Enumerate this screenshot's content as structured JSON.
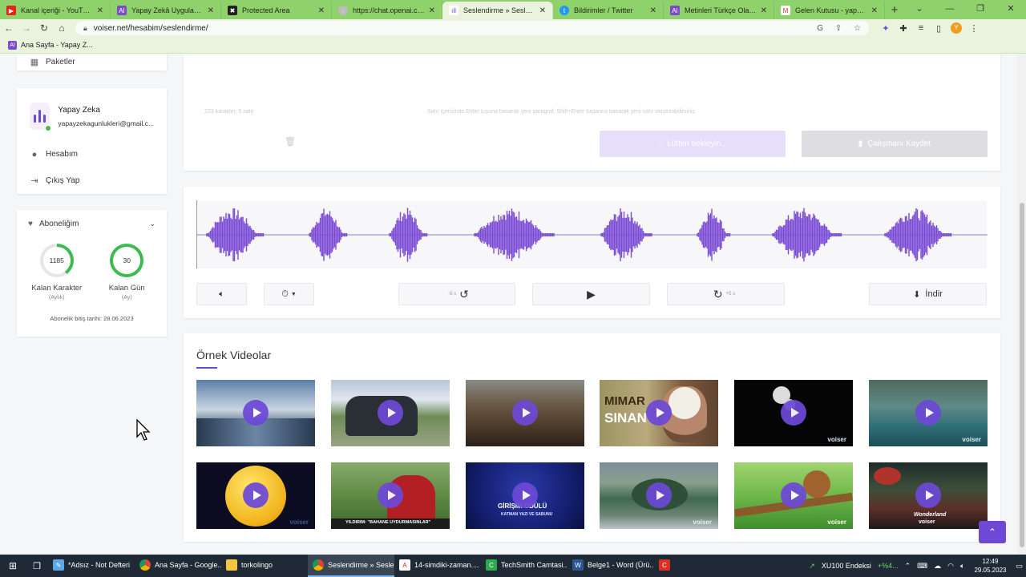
{
  "browser": {
    "tabs": [
      {
        "label": "Kanal içeriği - YouTube St...",
        "favicon": "youtube-icon",
        "color": "#e62117"
      },
      {
        "label": "Yapay Zekâ Uygulamaları...",
        "favicon": "ai-icon",
        "color": "#7b4bc9"
      },
      {
        "label": "Protected Area",
        "favicon": "shield-icon",
        "color": "#222222"
      },
      {
        "label": "https://chat.openai.com",
        "favicon": "globe-icon",
        "color": "#888888"
      },
      {
        "label": "Seslendirme » Seslendirme",
        "favicon": "voiser-icon",
        "color": "#6a4bd0",
        "active": true
      },
      {
        "label": "Bildirimler / Twitter",
        "favicon": "twitter-icon",
        "color": "#1d9bf0"
      },
      {
        "label": "Metinleri Türkçe Olarak Se...",
        "favicon": "ai-icon",
        "color": "#7b4bc9"
      },
      {
        "label": "Gelen Kutusu - yapayzeka...",
        "favicon": "gmail-icon",
        "color": "#d93025"
      }
    ],
    "url": "voiser.net/hesabim/seslendirme/",
    "bookmark": "Ana Sayfa - Yapay Z...",
    "avatar_letter": "Y"
  },
  "sidebar": {
    "packages_label": "Paketler",
    "user": {
      "name": "Yapay Zeka",
      "email": "yapayzekagunlukleri@gmail.c..."
    },
    "account_label": "Hesabım",
    "logout_label": "Çıkış Yap",
    "subscription": {
      "title": "Aboneliğim",
      "chars_value": "1185",
      "chars_label": "Kalan Karakter",
      "chars_period": "(Aylık)",
      "days_value": "30",
      "days_label": "Kalan Gün",
      "days_period": "(Ay)",
      "end_text": "Abonelik bitiş tarihi: 28.06.2023",
      "ring_color": "#3dbb4f"
    }
  },
  "editor": {
    "hint": "Satır içerisinde Enter tuşuna basarak yeni paragraf, Shift+Enter tuşlarına basarak yeni satır oluşturabilirsiniz.",
    "counter": "223 karakter, 5 satır",
    "wait_label": "Lütfen bekleyin...",
    "save_label": "Çalışmanı Kaydet"
  },
  "player": {
    "back_label": "-5 s",
    "forward_label": "+5 s",
    "download_label": "İndir",
    "wave_color": "#7b4bd6"
  },
  "videos": {
    "title": "Örnek Videolar",
    "brand": "voiser",
    "thumb_texts": {
      "mimar": "MIMAR",
      "sinan": "SINAN",
      "news_caption": "YILDIRIM: \"BAHANE UYDURMASINLAR\"",
      "award_line1": "GİRİŞİM ÖDÜLÜ",
      "award_line2": "KATMAN YAZI VE SABUNU",
      "wonderland": "Wonderland"
    }
  },
  "taskbar": {
    "apps": [
      {
        "label": "*Adsız - Not Defteri",
        "icon": "notepad-icon",
        "color": "#5aa9e6"
      },
      {
        "label": "Ana Sayfa - Google...",
        "icon": "chrome-icon",
        "color": "#4caf50"
      },
      {
        "label": "torkolingo",
        "icon": "folder-icon",
        "color": "#f3c744"
      },
      {
        "label": "Seslendirme » Sesle...",
        "icon": "chrome-icon",
        "color": "#4caf50",
        "active": true
      },
      {
        "label": "14-simdiki-zaman....",
        "icon": "pdf-icon",
        "color": "#d93025"
      },
      {
        "label": "TechSmith Camtasi...",
        "icon": "camtasia-icon",
        "color": "#2fa84f"
      },
      {
        "label": "Belge1 - Word (Ürü...",
        "icon": "word-icon",
        "color": "#2b5797"
      }
    ],
    "stock": "XU100 Endeksi",
    "stock_change": "+%4...",
    "time": "12:49",
    "date": "29.05.2023"
  }
}
